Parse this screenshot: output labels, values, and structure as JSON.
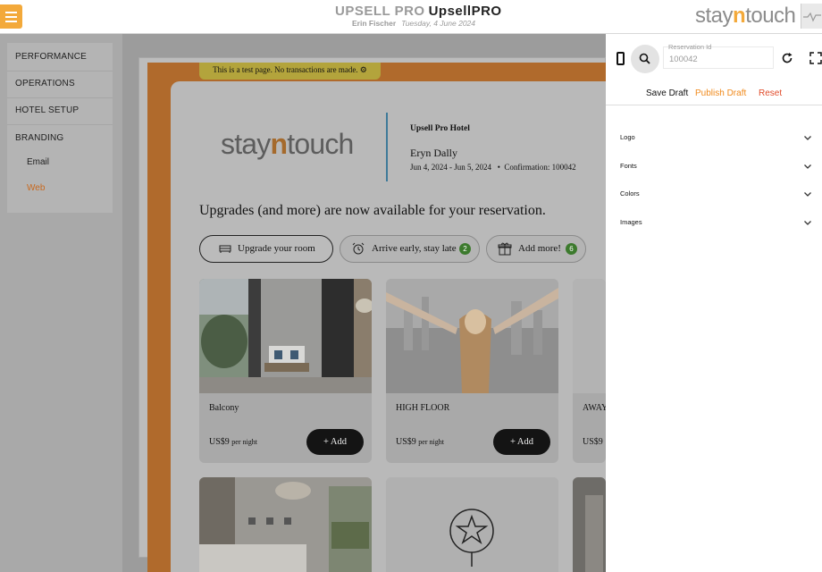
{
  "header": {
    "title_brand": "UPSELL PRO",
    "title_app": "UpsellPRO",
    "user": "Erin Fischer",
    "date": "Tuesday, 4 June 2024",
    "logo_stay": "stay",
    "logo_n": "n",
    "logo_touch": "touch"
  },
  "sidebar": {
    "items": [
      {
        "label": "PERFORMANCE"
      },
      {
        "label": "OPERATIONS"
      },
      {
        "label": "HOTEL SETUP"
      },
      {
        "label": "BRANDING"
      }
    ],
    "sub_items": [
      {
        "label": "Email",
        "active": false
      },
      {
        "label": "Web",
        "active": true
      }
    ]
  },
  "preview": {
    "test_banner": "This is a test page. No transactions are made. ⚙",
    "logo_stay": "stay",
    "logo_n": "n",
    "logo_touch": "touch",
    "hotel_name": "Upsell Pro Hotel",
    "guest_name": "Eryn Dally",
    "stay_dates": "Jun 4, 2024 - Jun 5, 2024",
    "confirmation": "Confirmation: 100042",
    "headline": "Upgrades (and more) are now available for your reservation.",
    "tabs": [
      {
        "label": "Upgrade your room",
        "icon": "bed-icon",
        "count": null,
        "selected": true
      },
      {
        "label": "Arrive early, stay late",
        "icon": "alarm-clock-icon",
        "count": "2",
        "selected": false
      },
      {
        "label": "Add more!",
        "icon": "gift-icon",
        "count": "6",
        "selected": false
      }
    ],
    "offers": [
      {
        "name": "Balcony",
        "price": "US$9",
        "unit": "per night",
        "button": "+ Add"
      },
      {
        "name": "HIGH FLOOR",
        "price": "US$9",
        "unit": "per night",
        "button": "+ Add"
      },
      {
        "name": "AWAY",
        "price": "US$9",
        "unit": "",
        "button": ""
      }
    ]
  },
  "panel": {
    "reservation_label": "Reservation Id",
    "reservation_value": "100042",
    "actions": {
      "save": "Save Draft",
      "publish": "Publish Draft",
      "reset": "Reset"
    },
    "sections": [
      {
        "label": "Logo"
      },
      {
        "label": "Fonts"
      },
      {
        "label": "Colors"
      },
      {
        "label": "Images"
      }
    ]
  },
  "colors": {
    "accent": "#f3a93a",
    "active_nav": "#c8691f",
    "publish": "#f08a1c",
    "reset": "#e04b2a",
    "badge_green": "#3c7a2d"
  }
}
